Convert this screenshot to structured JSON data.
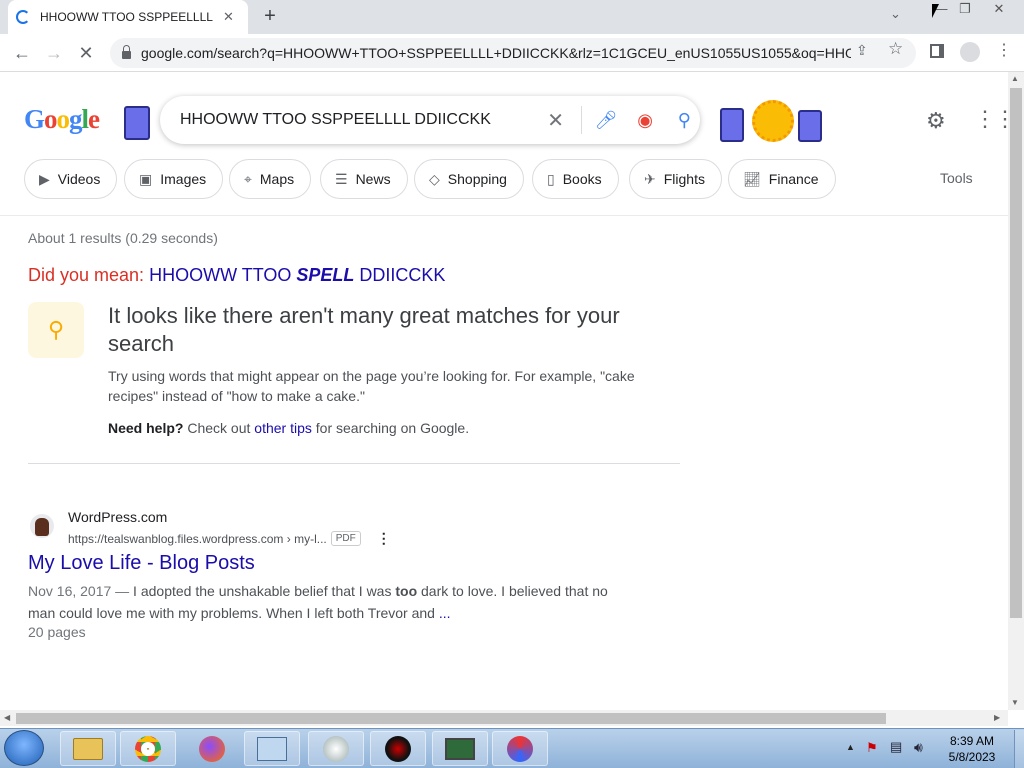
{
  "browser": {
    "tab_title": "HHOOWW TTOO SSPPEELLLL DD",
    "url": "google.com/search?q=HHOOWW+TTOO+SSPPEELLLL+DDIICCKK&rlz=1C1GCEU_enUS1055US1055&oq=HHOO..."
  },
  "search": {
    "query": "HHOOWW TTOO SSPPEELLLL DDIICCKK",
    "chips": [
      "Videos",
      "Images",
      "Maps",
      "News",
      "Shopping",
      "Books",
      "Flights",
      "Finance"
    ],
    "tools_label": "Tools"
  },
  "results": {
    "stats": "About 1 results (0.29 seconds)",
    "did_you_mean_label": "Did you mean:",
    "dym_pre": "HHOOWW TTOO ",
    "dym_em": "SPELL",
    "dym_post": " DDIICCKK",
    "notice_title": "It looks like there aren't many great matches for your search",
    "notice_body": "Try using words that might appear on the page you’re looking for. For example, \"cake recipes\" instead of \"how to make a cake.\"",
    "help_bold": "Need help?",
    "help_pre": " Check out ",
    "help_link": "other tips",
    "help_post": " for searching on Google."
  },
  "result": {
    "site": "WordPress.com",
    "cite": "https://tealswanblog.files.wordpress.com › my-l...",
    "pdf": "PDF",
    "title": "My Love Life - Blog Posts",
    "date": "Nov 16, 2017 —",
    "snippet_a": " I adopted the unshakable belief that I was ",
    "snippet_bold": "too",
    "snippet_b": " dark to love. I believed that no man could love me with my problems. When I left both Trevor and ",
    "ellipsis": "...",
    "pages": "20 pages"
  },
  "taskbar": {
    "time": "8:39 AM",
    "date": "5/8/2023"
  },
  "colors": {
    "link": "#1a0dab",
    "did_you_mean": "#d93025",
    "accent": "#1a73e8"
  }
}
